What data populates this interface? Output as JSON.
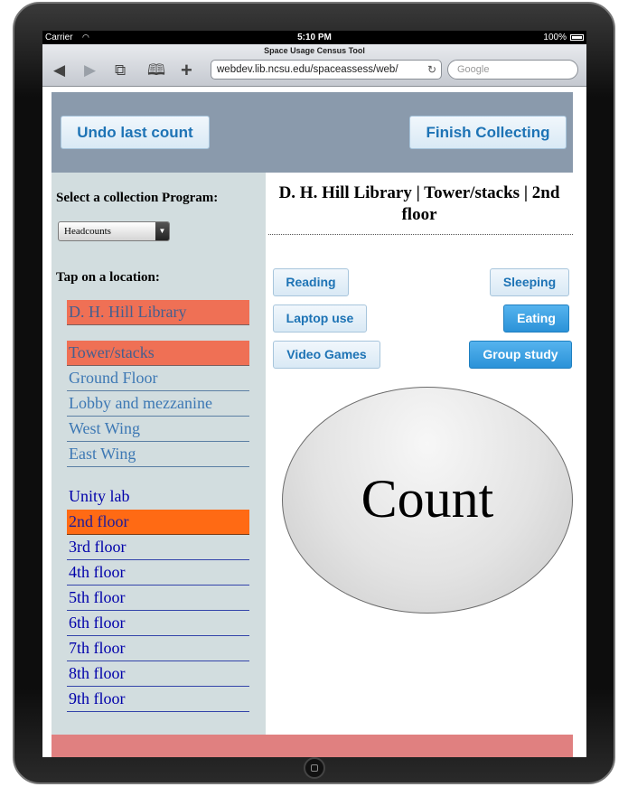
{
  "status_bar": {
    "carrier": "Carrier",
    "time": "5:10 PM",
    "battery": "100%"
  },
  "browser": {
    "page_title": "Space Usage Census Tool",
    "url": "webdev.lib.ncsu.edu/spaceassess/web/",
    "search_placeholder": "Google",
    "back_glyph": "◀",
    "forward_glyph": "▶",
    "tabs_glyph": "⧉",
    "bookmarks_glyph": "🕮",
    "add_glyph": "+",
    "reload_glyph": "↻"
  },
  "toolbar": {
    "undo_label": "Undo last count",
    "finish_label": "Finish Collecting"
  },
  "sidebar": {
    "program_label": "Select a collection Program:",
    "program_selected": "Headcounts",
    "location_label": "Tap on a location:",
    "library": "D. H. Hill Library",
    "areas": [
      "Tower/stacks",
      "Ground Floor",
      "Lobby and mezzanine",
      "West Wing",
      "East Wing"
    ],
    "floors": [
      "Unity lab",
      "2nd floor",
      "3rd floor",
      "4th floor",
      "5th floor",
      "6th floor",
      "7th floor",
      "8th floor",
      "9th floor"
    ]
  },
  "main": {
    "heading": "D. H. Hill Library | Tower/stacks | 2nd floor",
    "activities": {
      "reading": "Reading",
      "sleeping": "Sleeping",
      "laptop": "Laptop use",
      "eating": "Eating",
      "games": "Video Games",
      "group": "Group study"
    },
    "count_label": "Count"
  },
  "colors": {
    "selected_library": "#ef7055",
    "selected_floor": "#ff6a14",
    "active_button": "#2b92d8",
    "footer": "#e08080"
  }
}
